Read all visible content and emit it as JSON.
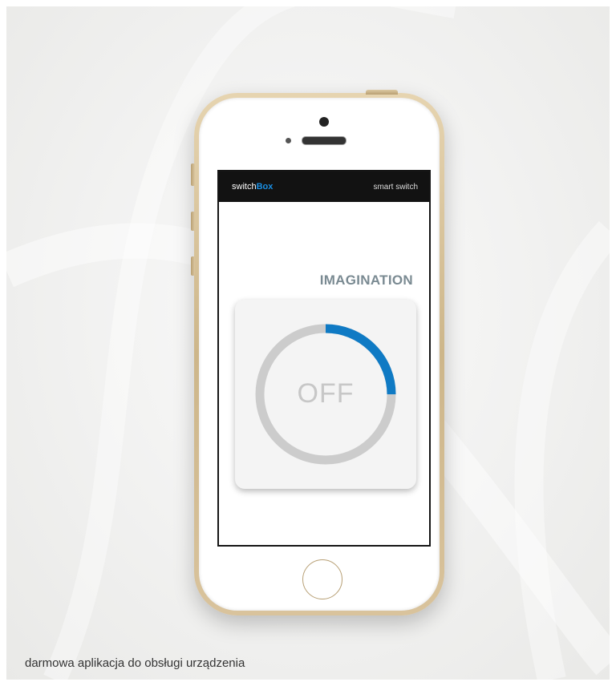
{
  "app": {
    "brand_prefix": "switch",
    "brand_suffix": "Box",
    "subtitle": "smart switch"
  },
  "device": {
    "name": "IMAGINATION",
    "state_label": "OFF",
    "ring_progress": 0.25
  },
  "caption": "darmowa aplikacja do obsługi urządzenia",
  "colors": {
    "accent": "#0f7ac4",
    "ring_track": "#cccccc",
    "appbar": "#121212"
  }
}
